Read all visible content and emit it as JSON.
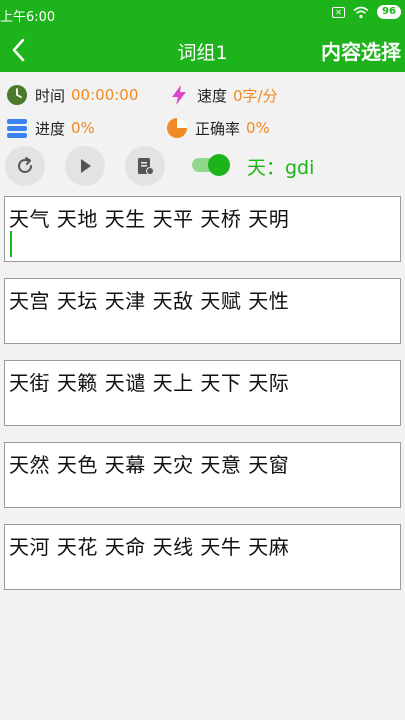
{
  "status": {
    "time": "上午6:00",
    "battery": "96"
  },
  "header": {
    "title": "词组1",
    "select_label": "内容选择"
  },
  "stats": {
    "time_label": "时间",
    "time_value": "00:00:00",
    "speed_label": "速度",
    "speed_value": "0字/分",
    "progress_label": "进度",
    "progress_value": "0%",
    "accuracy_label": "正确率",
    "accuracy_value": "0%"
  },
  "toggle": {
    "on": true
  },
  "hint": "天：gdi",
  "word_groups": [
    "天气 天地 天生 天平 天桥 天明",
    "天宫 天坛 天津 天敌 天赋 天性",
    "天街 天籁 天谴 天上 天下 天际",
    "天然 天色 天幕 天灾 天意 天窗",
    "天河 天花 天命 天线 天牛 天麻"
  ],
  "icons": {
    "back": "back-arrow-icon",
    "clock": "clock-icon",
    "speed": "lightning-icon",
    "progress": "progress-bars-icon",
    "accuracy": "pie-chart-icon",
    "restart": "refresh-icon",
    "play": "play-icon",
    "record": "record-icon"
  },
  "colors": {
    "primary": "#1db31b",
    "accent": "#f08a24",
    "speed_icon": "#d946c6",
    "progress_icon": "#3b82f6"
  }
}
